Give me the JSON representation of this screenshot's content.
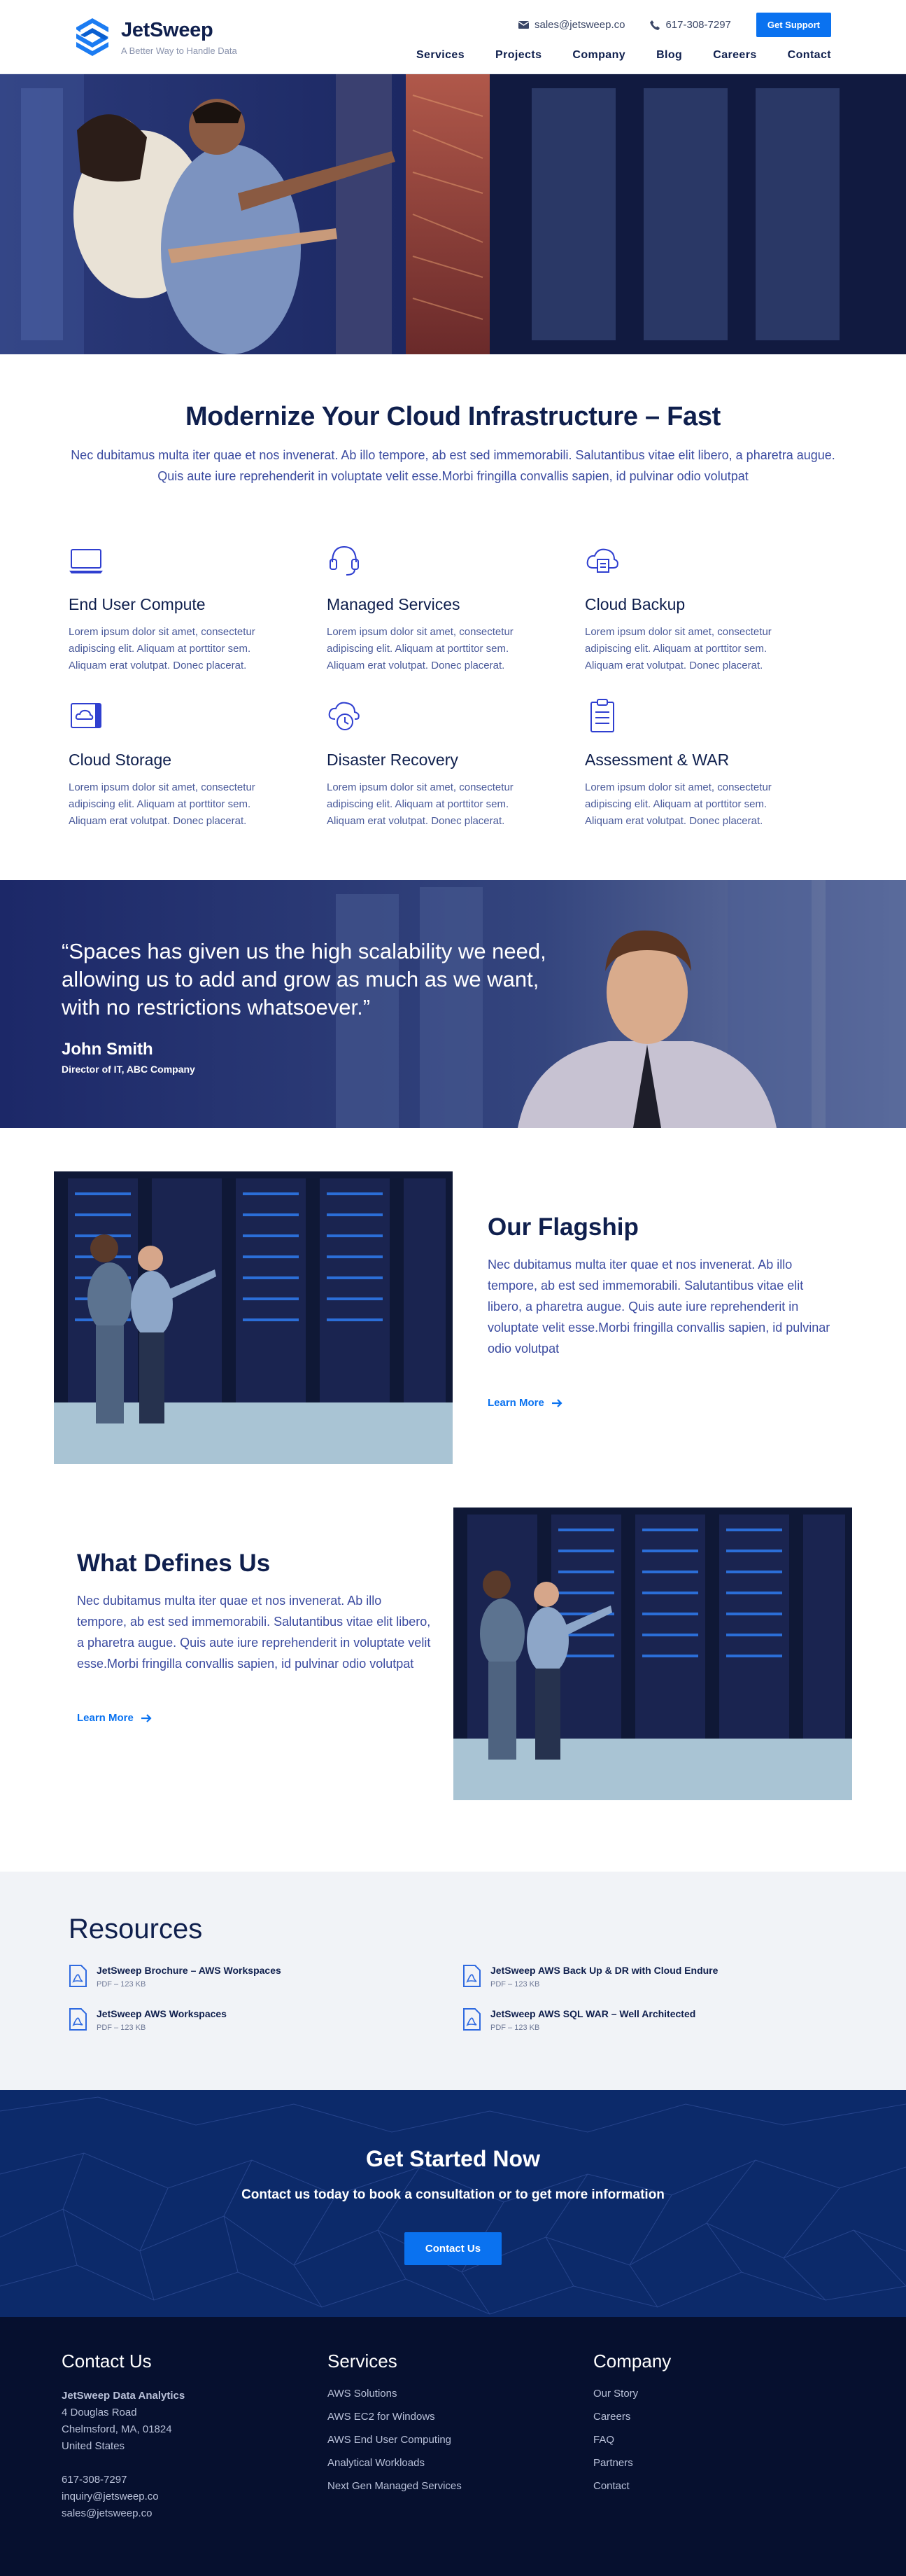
{
  "header": {
    "brand": "JetSweep",
    "tagline": "A Better Way to Handle Data",
    "email": "sales@jetsweep.co",
    "phone": "617-308-7297",
    "support_button": "Get Support",
    "nav": [
      "Services",
      "Projects",
      "Company",
      "Blog",
      "Careers",
      "Contact"
    ]
  },
  "intro": {
    "title": "Modernize Your Cloud Infrastructure – Fast",
    "body": "Nec dubitamus multa iter quae et nos invenerat. Ab illo tempore, ab est sed immemorabili. Salutantibus vitae elit libero, a pharetra augue. Quis aute iure reprehenderit in voluptate velit esse.Morbi fringilla convallis sapien, id pulvinar odio volutpat"
  },
  "services": [
    {
      "title": "End User Compute",
      "icon": "laptop-icon",
      "body": "Lorem ipsum dolor sit amet, consectetur adipiscing elit. Aliquam at porttitor sem. Aliquam erat volutpat. Donec placerat."
    },
    {
      "title": "Managed Services",
      "icon": "headset-icon",
      "body": "Lorem ipsum dolor sit amet, consectetur adipiscing elit. Aliquam at porttitor sem. Aliquam erat volutpat. Donec placerat."
    },
    {
      "title": "Cloud Backup",
      "icon": "cloud-backup-icon",
      "body": "Lorem ipsum dolor sit amet, consectetur adipiscing elit. Aliquam at porttitor sem. Aliquam erat volutpat. Donec placerat."
    },
    {
      "title": "Cloud Storage",
      "icon": "cloud-storage-icon",
      "body": "Lorem ipsum dolor sit amet, consectetur adipiscing elit. Aliquam at porttitor sem. Aliquam erat volutpat. Donec placerat."
    },
    {
      "title": "Disaster Recovery",
      "icon": "disaster-recovery-icon",
      "body": "Lorem ipsum dolor sit amet, consectetur adipiscing elit. Aliquam at porttitor sem. Aliquam erat volutpat. Donec placerat."
    },
    {
      "title": "Assessment & WAR",
      "icon": "clipboard-icon",
      "body": "Lorem ipsum dolor sit amet, consectetur adipiscing elit. Aliquam at porttitor sem. Aliquam erat volutpat. Donec placerat."
    }
  ],
  "testimonial": {
    "quote": "“Spaces has given us the high scalability we need, allowing us to add and grow as much as we want, with no restrictions whatsoever.”",
    "name": "John Smith",
    "role": "Director of IT, ABC Company"
  },
  "flagship": {
    "title": "Our Flagship",
    "body": "Nec dubitamus multa iter quae et nos invenerat. Ab illo tempore, ab est sed immemorabili. Salutantibus vitae elit libero, a pharetra augue. Quis aute iure reprehenderit in voluptate velit esse.Morbi fringilla convallis sapien, id pulvinar odio volutpat",
    "link": "Learn More"
  },
  "defines": {
    "title": "What Defines Us",
    "body": "Nec dubitamus multa iter quae et nos invenerat. Ab illo tempore, ab est sed immemorabili. Salutantibus vitae elit libero, a pharetra augue. Quis aute iure reprehenderit in voluptate velit esse.Morbi fringilla convallis sapien, id pulvinar odio volutpat",
    "link": "Learn More"
  },
  "resources": {
    "title": "Resources",
    "items": [
      {
        "title": "JetSweep Brochure – AWS Workspaces",
        "meta": "PDF – 123 KB"
      },
      {
        "title": "JetSweep AWS Back Up & DR with Cloud Endure",
        "meta": "PDF – 123 KB"
      },
      {
        "title": "JetSweep AWS Workspaces",
        "meta": "PDF – 123 KB"
      },
      {
        "title": "JetSweep AWS SQL WAR – Well Architected",
        "meta": "PDF – 123 KB"
      }
    ]
  },
  "cta": {
    "title": "Get Started Now",
    "subtitle": "Contact us today to book a consultation or to get more information",
    "button": "Contact Us"
  },
  "footer": {
    "contact": {
      "title": "Contact Us",
      "company": "JetSweep Data Analytics",
      "address1": "4 Douglas Road",
      "address2": "Chelmsford, MA, 01824",
      "address3": "United States",
      "phone": "617-308-7297",
      "email1": "inquiry@jetsweep.co",
      "email2": "sales@jetsweep.co"
    },
    "services": {
      "title": "Services",
      "links": [
        "AWS Solutions",
        "AWS EC2 for Windows",
        "AWS End User Computing",
        "Analytical Workloads",
        "Next Gen Managed Services"
      ]
    },
    "company": {
      "title": "Company",
      "links": [
        "Our Story",
        "Careers",
        "FAQ",
        "Partners",
        "Contact"
      ]
    }
  },
  "colors": {
    "brand_blue": "#0a72f0",
    "navy": "#0f1f4d",
    "footer_bg": "#06102f"
  }
}
